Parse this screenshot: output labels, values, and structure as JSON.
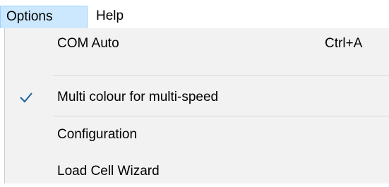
{
  "menubar": {
    "items": [
      {
        "label": "Options",
        "active": true
      },
      {
        "label": "Help",
        "active": false
      }
    ]
  },
  "options_menu": {
    "items": [
      {
        "label": "COM Auto",
        "shortcut": "Ctrl+A",
        "checked": false
      },
      {
        "label": "Multi colour for multi-speed",
        "checked": true
      },
      {
        "label": "Configuration",
        "checked": false
      },
      {
        "label": "Load Cell Wizard",
        "checked": false
      }
    ]
  },
  "colors": {
    "active_menu_bg": "#cce8ff",
    "active_menu_border": "#99d1ff",
    "dropdown_bg": "#f2f2f2",
    "check_color": "#1e5f9e"
  },
  "icons": {
    "check": "checkmark-icon"
  }
}
